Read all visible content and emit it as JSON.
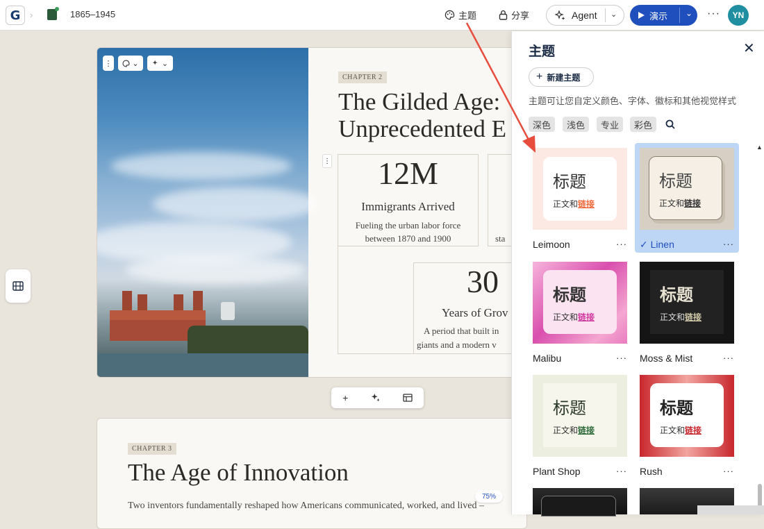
{
  "topbar": {
    "logo": "G",
    "doc_title": "1865–1945",
    "theme_label": "主题",
    "share_label": "分享",
    "agent_label": "Agent",
    "present_label": "演示",
    "more_label": "···",
    "avatar_initials": "YN"
  },
  "card1": {
    "chapter": "CHAPTER 2",
    "title_line1": "The Gilded Age:",
    "title_line2": "Unprecedented E",
    "stats": [
      {
        "num": "12M",
        "label": "Immigrants Arrived",
        "desc1": "Fueling the urban labor force",
        "desc2": "between 1870 and 1900"
      },
      {
        "num": "",
        "label": "",
        "desc1": "",
        "desc2": "sta"
      },
      {
        "num": "30",
        "label": "Years of Grov",
        "desc1": "A period that built in",
        "desc2": "giants and a modern v"
      }
    ]
  },
  "card2": {
    "chapter": "CHAPTER 3",
    "title": "The Age of Innovation",
    "body": "Two inventors fundamentally reshaped how Americans communicated, worked, and lived –"
  },
  "zoom": "75%",
  "panel": {
    "title": "主题",
    "new_theme": "新建主题",
    "description": "主题可让您自定义颜色、字体、徽标和其他视觉样式",
    "filters": [
      "深色",
      "浅色",
      "专业",
      "彩色"
    ],
    "themes": [
      {
        "name": "Leimoon",
        "heading": "标题",
        "body": "正文和",
        "link": "链接",
        "selected": false
      },
      {
        "name": "Linen",
        "heading": "标题",
        "body": "正文和",
        "link": "链接",
        "selected": true
      },
      {
        "name": "Malibu",
        "heading": "标题",
        "body": "正文和",
        "link": "链接",
        "selected": false
      },
      {
        "name": "Moss & Mist",
        "heading": "标题",
        "body": "正文和",
        "link": "链接",
        "selected": false
      },
      {
        "name": "Plant Shop",
        "heading": "标题",
        "body": "正文和",
        "link": "链接",
        "selected": false
      },
      {
        "name": "Rush",
        "heading": "标题",
        "body": "正文和",
        "link": "链接",
        "selected": false
      }
    ],
    "check_mark": "✓"
  },
  "colors": {
    "accent": "#1f4fbd",
    "selected_bg": "#bed6f6",
    "annotation_arrow": "#e74c3c"
  }
}
